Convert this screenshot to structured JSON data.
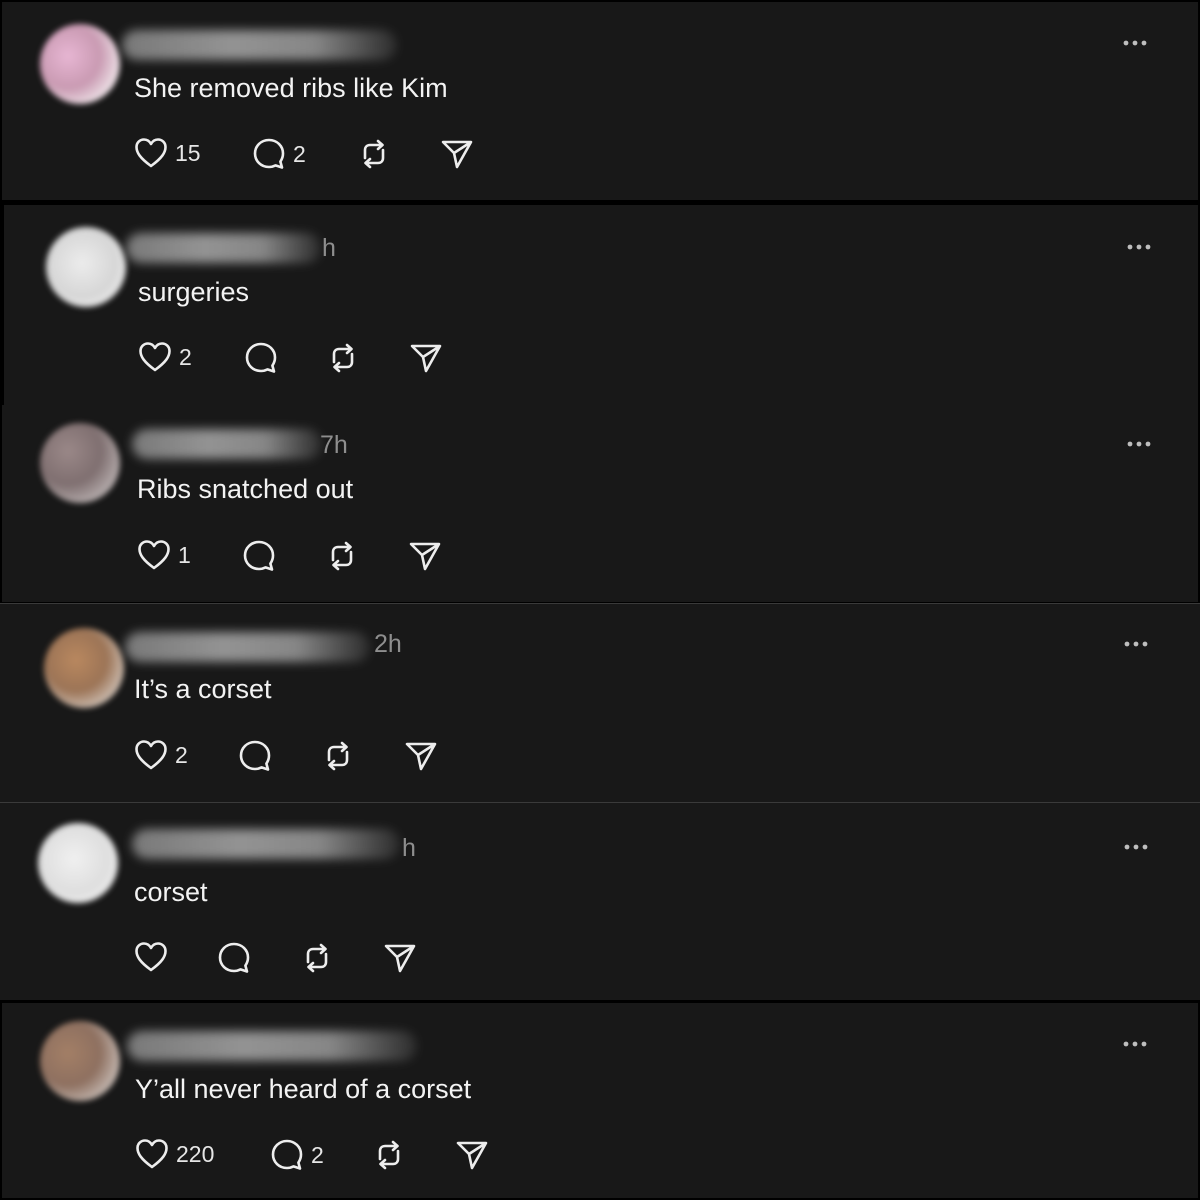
{
  "posts": [
    {
      "time": "",
      "text": "She removed ribs like Kim",
      "likes": "15",
      "replies": "2",
      "avatar_color": "#d7a5c0"
    },
    {
      "time": "h",
      "text": "surgeries",
      "likes": "2",
      "replies": "",
      "avatar_color": "#dcdcdc"
    },
    {
      "time": "7h",
      "text": "Ribs snatched out",
      "likes": "1",
      "replies": "",
      "avatar_color": "#8f7f7f"
    },
    {
      "time": "2h",
      "text": "It’s a corset",
      "likes": "2",
      "replies": "",
      "avatar_color": "#b58a66"
    },
    {
      "time": "h",
      "text": "corset",
      "likes": "",
      "replies": "",
      "avatar_color": "#e8e8e8"
    },
    {
      "time": "",
      "text": "Y’all never heard of a corset",
      "likes": "220",
      "replies": "2",
      "avatar_color": "#a38068"
    }
  ],
  "icons": {
    "like": "heart-icon",
    "reply": "comment-icon",
    "repost": "repost-icon",
    "share": "send-icon",
    "more": "more-options-icon"
  }
}
